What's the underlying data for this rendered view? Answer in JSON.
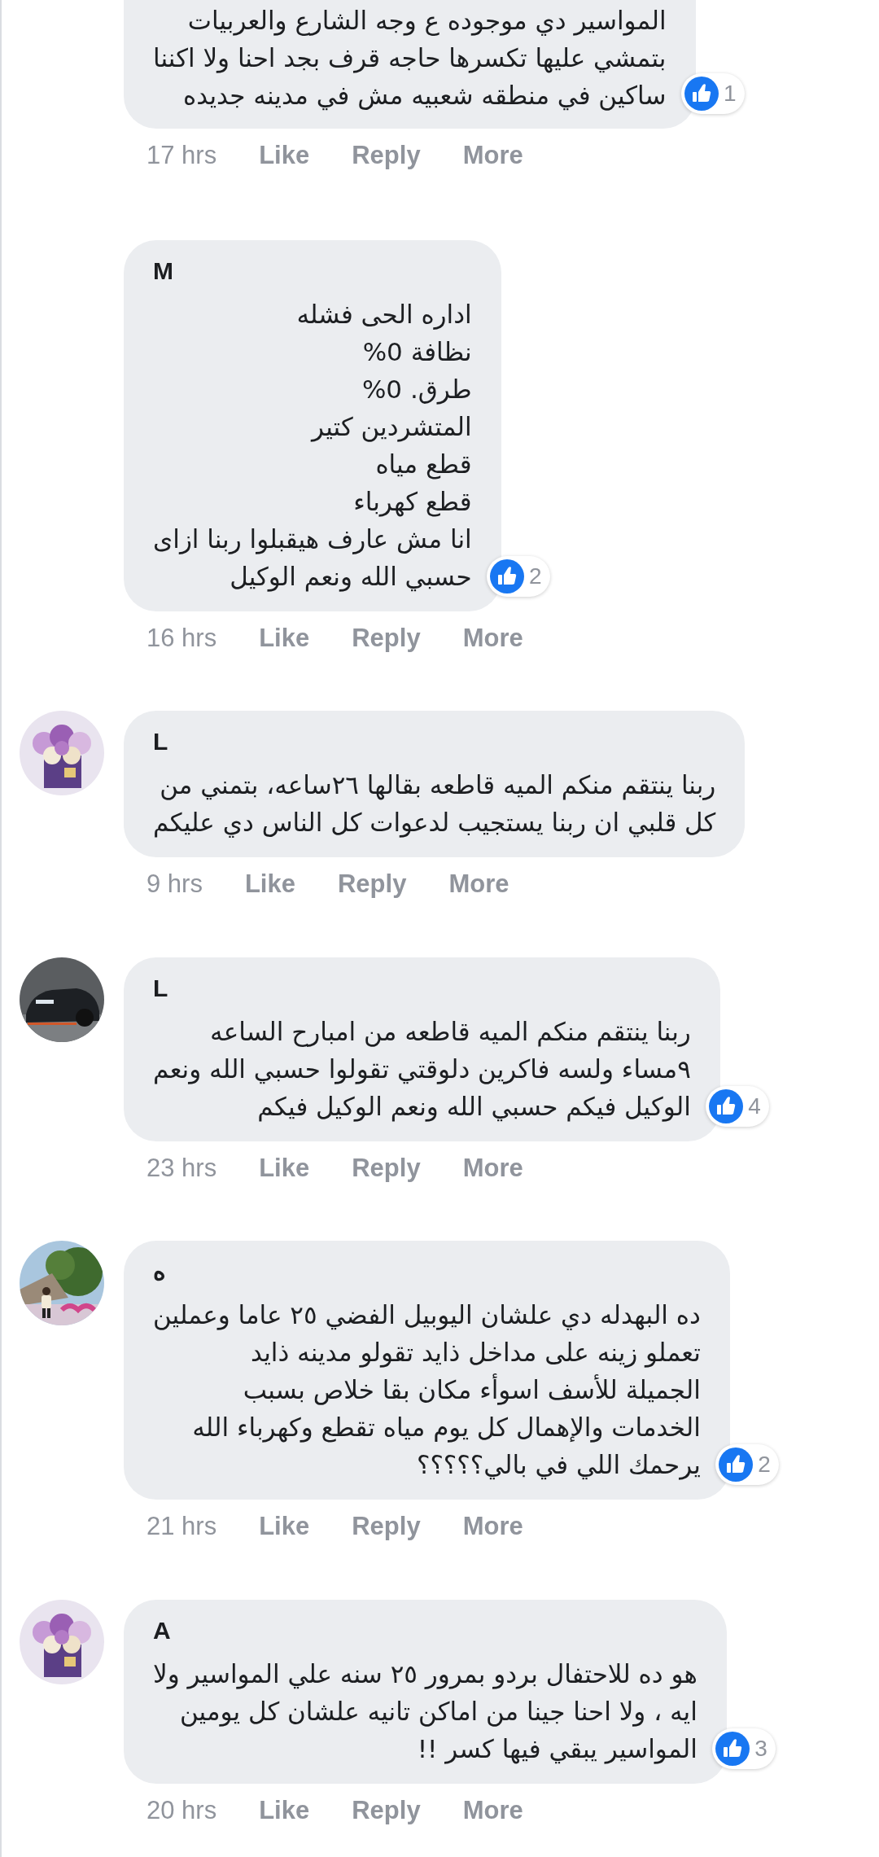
{
  "comments": [
    {
      "cut_top": true,
      "text": "المواسير دي موجوده ع وجه الشارع والعربيات\nبتمشي عليها تكسرها حاجه قرف بجد احنا ولا اكننا\nساكين في منطقه شعبيه مش في مدينه جديده",
      "likes": "1",
      "time": "17 hrs",
      "like_action": "Like",
      "reply_action": "Reply",
      "more_action": "More"
    },
    {
      "name": "M",
      "text": "اداره الحى فشله\nنظافة 0%\nطرق. 0%\nالمتشردين كتير\nقطع مياه\nقطع كهرباء\nانا مش عارف هيقبلوا ربنا ازاى\nحسبي الله ونعم الوكيل",
      "likes": "2",
      "time": "16 hrs",
      "like_action": "Like",
      "reply_action": "Reply",
      "more_action": "More"
    },
    {
      "name": "L",
      "text": "ربنا ينتقم منكم الميه قاطعه بقالها ٢٦ساعه، بتمني من\nكل قلبي ان ربنا يستجيب لدعوات كل الناس دي عليكم",
      "time": "9 hrs",
      "like_action": "Like",
      "reply_action": "Reply",
      "more_action": "More"
    },
    {
      "name": "L",
      "text": "ربنا ينتقم منكم الميه قاطعه من امبارح الساعه\n٩مساء ولسه فاكرين دلوقتي تقولوا حسبي الله ونعم\nالوكيل فيكم حسبي الله ونعم الوكيل فيكم",
      "likes": "4",
      "time": "23 hrs",
      "like_action": "Like",
      "reply_action": "Reply",
      "more_action": "More"
    },
    {
      "name": "ه",
      "text": "ده البهدله دي علشان اليوبيل الفضي ٢٥ عاما وعملين\nتعملو زينه على مداخل ذايد تقولو مدينه ذايد\nالجميلة للأسف اسوأء مكان بقا خلاص بسبب\nالخدمات والإهمال كل يوم مياه تقطع وكهرباء الله\nيرحمك اللي في بالي؟؟؟؟؟",
      "likes": "2",
      "time": "21 hrs",
      "like_action": "Like",
      "reply_action": "Reply",
      "more_action": "More"
    },
    {
      "name": "A",
      "text": "هو ده للاحتفال بردو بمرور ٢٥ سنه علي المواسير ولا\nايه ، ولا احنا جينا من اماكن تانيه علشان كل يومين\nالمواسير يبقي فيها كسر !!",
      "likes": "3",
      "time": "20 hrs",
      "like_action": "Like",
      "reply_action": "Reply",
      "more_action": "More"
    }
  ]
}
